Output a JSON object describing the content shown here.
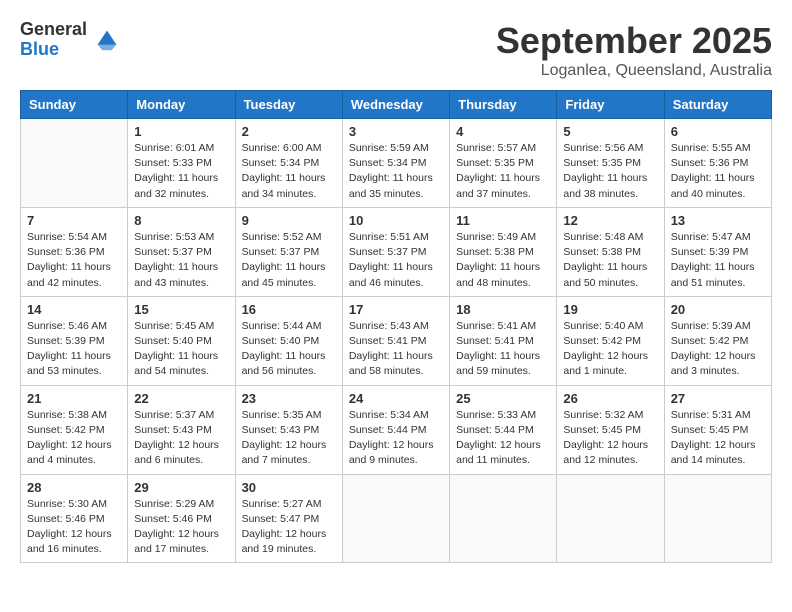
{
  "header": {
    "logo_general": "General",
    "logo_blue": "Blue",
    "month_title": "September 2025",
    "location": "Loganlea, Queensland, Australia"
  },
  "columns": [
    "Sunday",
    "Monday",
    "Tuesday",
    "Wednesday",
    "Thursday",
    "Friday",
    "Saturday"
  ],
  "weeks": [
    [
      {
        "day": "",
        "info": ""
      },
      {
        "day": "1",
        "info": "Sunrise: 6:01 AM\nSunset: 5:33 PM\nDaylight: 11 hours\nand 32 minutes."
      },
      {
        "day": "2",
        "info": "Sunrise: 6:00 AM\nSunset: 5:34 PM\nDaylight: 11 hours\nand 34 minutes."
      },
      {
        "day": "3",
        "info": "Sunrise: 5:59 AM\nSunset: 5:34 PM\nDaylight: 11 hours\nand 35 minutes."
      },
      {
        "day": "4",
        "info": "Sunrise: 5:57 AM\nSunset: 5:35 PM\nDaylight: 11 hours\nand 37 minutes."
      },
      {
        "day": "5",
        "info": "Sunrise: 5:56 AM\nSunset: 5:35 PM\nDaylight: 11 hours\nand 38 minutes."
      },
      {
        "day": "6",
        "info": "Sunrise: 5:55 AM\nSunset: 5:36 PM\nDaylight: 11 hours\nand 40 minutes."
      }
    ],
    [
      {
        "day": "7",
        "info": "Sunrise: 5:54 AM\nSunset: 5:36 PM\nDaylight: 11 hours\nand 42 minutes."
      },
      {
        "day": "8",
        "info": "Sunrise: 5:53 AM\nSunset: 5:37 PM\nDaylight: 11 hours\nand 43 minutes."
      },
      {
        "day": "9",
        "info": "Sunrise: 5:52 AM\nSunset: 5:37 PM\nDaylight: 11 hours\nand 45 minutes."
      },
      {
        "day": "10",
        "info": "Sunrise: 5:51 AM\nSunset: 5:37 PM\nDaylight: 11 hours\nand 46 minutes."
      },
      {
        "day": "11",
        "info": "Sunrise: 5:49 AM\nSunset: 5:38 PM\nDaylight: 11 hours\nand 48 minutes."
      },
      {
        "day": "12",
        "info": "Sunrise: 5:48 AM\nSunset: 5:38 PM\nDaylight: 11 hours\nand 50 minutes."
      },
      {
        "day": "13",
        "info": "Sunrise: 5:47 AM\nSunset: 5:39 PM\nDaylight: 11 hours\nand 51 minutes."
      }
    ],
    [
      {
        "day": "14",
        "info": "Sunrise: 5:46 AM\nSunset: 5:39 PM\nDaylight: 11 hours\nand 53 minutes."
      },
      {
        "day": "15",
        "info": "Sunrise: 5:45 AM\nSunset: 5:40 PM\nDaylight: 11 hours\nand 54 minutes."
      },
      {
        "day": "16",
        "info": "Sunrise: 5:44 AM\nSunset: 5:40 PM\nDaylight: 11 hours\nand 56 minutes."
      },
      {
        "day": "17",
        "info": "Sunrise: 5:43 AM\nSunset: 5:41 PM\nDaylight: 11 hours\nand 58 minutes."
      },
      {
        "day": "18",
        "info": "Sunrise: 5:41 AM\nSunset: 5:41 PM\nDaylight: 11 hours\nand 59 minutes."
      },
      {
        "day": "19",
        "info": "Sunrise: 5:40 AM\nSunset: 5:42 PM\nDaylight: 12 hours\nand 1 minute."
      },
      {
        "day": "20",
        "info": "Sunrise: 5:39 AM\nSunset: 5:42 PM\nDaylight: 12 hours\nand 3 minutes."
      }
    ],
    [
      {
        "day": "21",
        "info": "Sunrise: 5:38 AM\nSunset: 5:42 PM\nDaylight: 12 hours\nand 4 minutes."
      },
      {
        "day": "22",
        "info": "Sunrise: 5:37 AM\nSunset: 5:43 PM\nDaylight: 12 hours\nand 6 minutes."
      },
      {
        "day": "23",
        "info": "Sunrise: 5:35 AM\nSunset: 5:43 PM\nDaylight: 12 hours\nand 7 minutes."
      },
      {
        "day": "24",
        "info": "Sunrise: 5:34 AM\nSunset: 5:44 PM\nDaylight: 12 hours\nand 9 minutes."
      },
      {
        "day": "25",
        "info": "Sunrise: 5:33 AM\nSunset: 5:44 PM\nDaylight: 12 hours\nand 11 minutes."
      },
      {
        "day": "26",
        "info": "Sunrise: 5:32 AM\nSunset: 5:45 PM\nDaylight: 12 hours\nand 12 minutes."
      },
      {
        "day": "27",
        "info": "Sunrise: 5:31 AM\nSunset: 5:45 PM\nDaylight: 12 hours\nand 14 minutes."
      }
    ],
    [
      {
        "day": "28",
        "info": "Sunrise: 5:30 AM\nSunset: 5:46 PM\nDaylight: 12 hours\nand 16 minutes."
      },
      {
        "day": "29",
        "info": "Sunrise: 5:29 AM\nSunset: 5:46 PM\nDaylight: 12 hours\nand 17 minutes."
      },
      {
        "day": "30",
        "info": "Sunrise: 5:27 AM\nSunset: 5:47 PM\nDaylight: 12 hours\nand 19 minutes."
      },
      {
        "day": "",
        "info": ""
      },
      {
        "day": "",
        "info": ""
      },
      {
        "day": "",
        "info": ""
      },
      {
        "day": "",
        "info": ""
      }
    ]
  ]
}
